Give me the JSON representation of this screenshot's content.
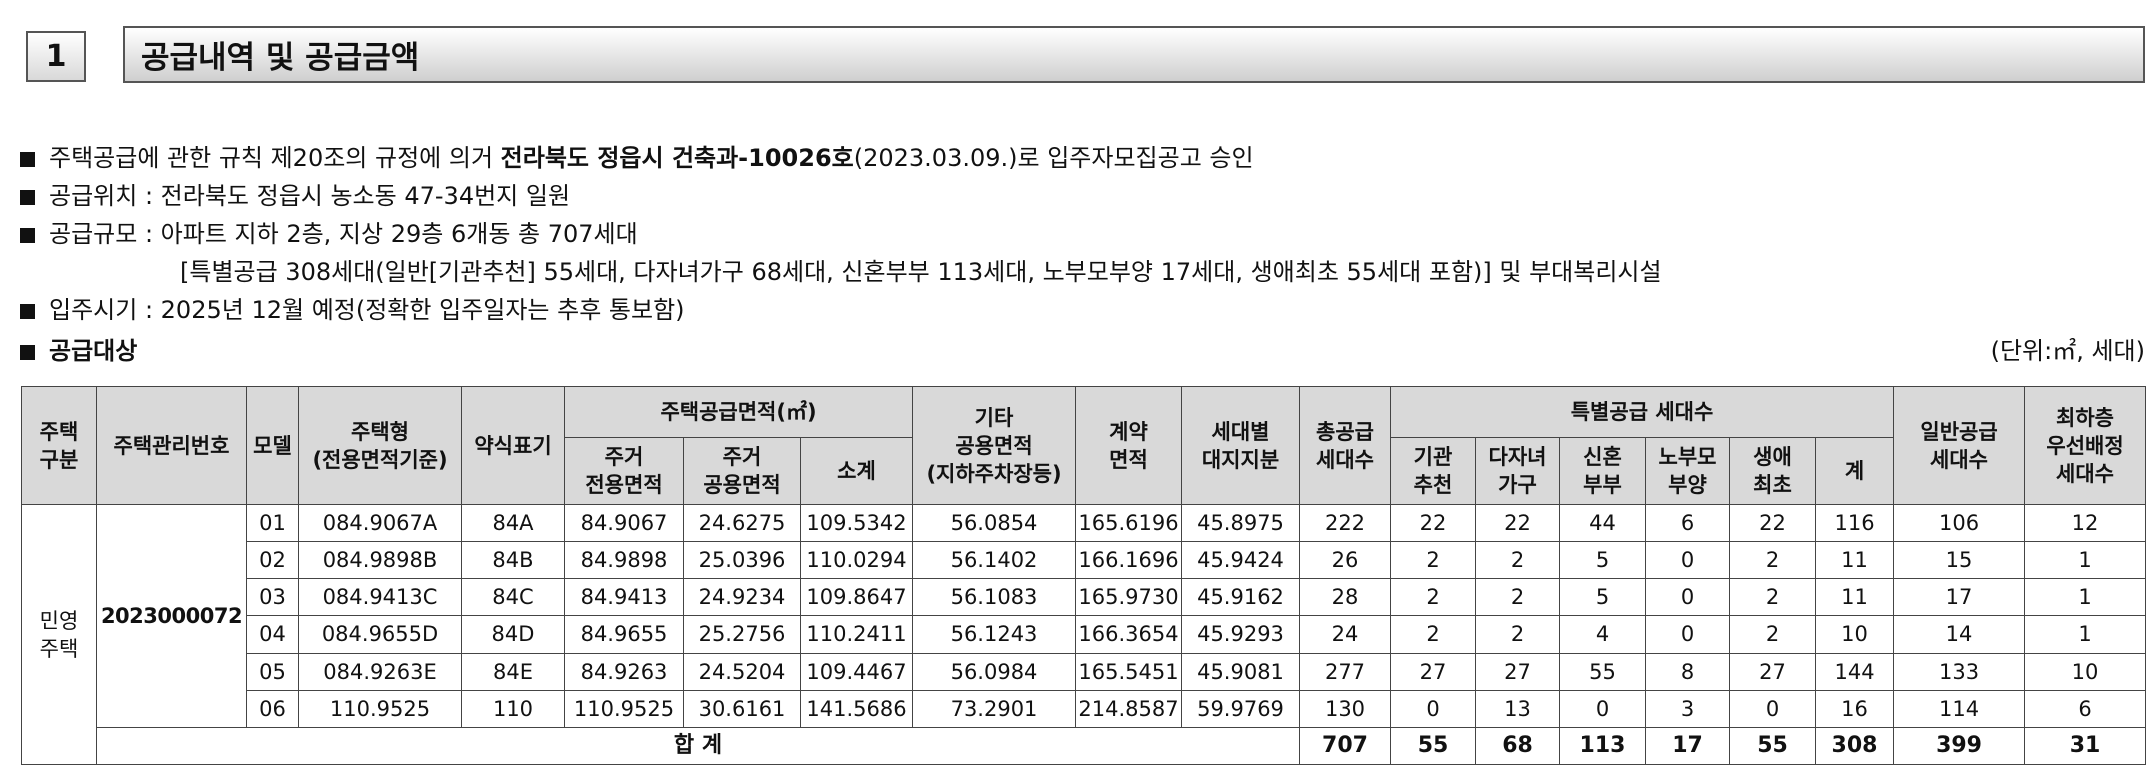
{
  "section": {
    "number": "1",
    "title": "공급내역 및 공급금액"
  },
  "notices": {
    "approval_prefix": "주택공급에 관한 규칙 제20조의 규정에 의거 ",
    "approval_bold": "전라북도 정읍시 건축과-10026호",
    "approval_suffix": "(2023.03.09.)로 입주자모집공고 승인",
    "location": "공급위치 : 전라북도 정읍시 농소동 47-34번지 일원",
    "scale": "공급규모 : 아파트 지하 2층, 지상 29층 6개동 총 707세대",
    "scale_detail": "[특별공급 308세대(일반[기관추천] 55세대, 다자녀가구 68세대, 신혼부부 113세대, 노부모부양 17세대, 생애최초 55세대 포함)] 및 부대복리시설",
    "move_in": "입주시기 : 2025년 12월 예정(정확한 입주일자는 추후 통보함)",
    "target_heading": "공급대상",
    "unit": "(단위:㎡, 세대)"
  },
  "table": {
    "headers": {
      "house_type_div": "주택\n구분",
      "mgmt_no": "주택관리번호",
      "model": "모델",
      "house_type": "주택형\n(전용면적기준)",
      "abbr": "약식표기",
      "supply_area": "주택공급면적(㎡)",
      "exclusive": "주거\n전용면적",
      "common": "주거\n공용면적",
      "subtotal": "소계",
      "other_common": "기타\n공용면적\n(지하주차장등)",
      "contract_area": "계약\n면적",
      "land_share": "세대별\n대지지분",
      "total_supply": "총공급\n세대수",
      "special": "특별공급 세대수",
      "inst": "기관\n추천",
      "multi": "다자녀\n가구",
      "newlywed": "신혼\n부부",
      "elderly": "노부모\n부양",
      "first": "생애\n최초",
      "special_sum": "계",
      "general": "일반공급\n세대수",
      "lowest_floor": "최하층\n우선배정\n세대수"
    },
    "house_type_div": "민영\n주택",
    "mgmt_no": "2023000072",
    "rows": [
      {
        "model": "01",
        "type": "084.9067A",
        "abbr": "84A",
        "excl": "84.9067",
        "comm": "24.6275",
        "sub": "109.5342",
        "other": "56.0854",
        "contract": "165.6196",
        "land": "45.8975",
        "total": "222",
        "inst": "22",
        "multi": "22",
        "newly": "44",
        "elder": "6",
        "first": "22",
        "sp": "116",
        "gen": "106",
        "low": "12"
      },
      {
        "model": "02",
        "type": "084.9898B",
        "abbr": "84B",
        "excl": "84.9898",
        "comm": "25.0396",
        "sub": "110.0294",
        "other": "56.1402",
        "contract": "166.1696",
        "land": "45.9424",
        "total": "26",
        "inst": "2",
        "multi": "2",
        "newly": "5",
        "elder": "0",
        "first": "2",
        "sp": "11",
        "gen": "15",
        "low": "1"
      },
      {
        "model": "03",
        "type": "084.9413C",
        "abbr": "84C",
        "excl": "84.9413",
        "comm": "24.9234",
        "sub": "109.8647",
        "other": "56.1083",
        "contract": "165.9730",
        "land": "45.9162",
        "total": "28",
        "inst": "2",
        "multi": "2",
        "newly": "5",
        "elder": "0",
        "first": "2",
        "sp": "11",
        "gen": "17",
        "low": "1"
      },
      {
        "model": "04",
        "type": "084.9655D",
        "abbr": "84D",
        "excl": "84.9655",
        "comm": "25.2756",
        "sub": "110.2411",
        "other": "56.1243",
        "contract": "166.3654",
        "land": "45.9293",
        "total": "24",
        "inst": "2",
        "multi": "2",
        "newly": "4",
        "elder": "0",
        "first": "2",
        "sp": "10",
        "gen": "14",
        "low": "1"
      },
      {
        "model": "05",
        "type": "084.9263E",
        "abbr": "84E",
        "excl": "84.9263",
        "comm": "24.5204",
        "sub": "109.4467",
        "other": "56.0984",
        "contract": "165.5451",
        "land": "45.9081",
        "total": "277",
        "inst": "27",
        "multi": "27",
        "newly": "55",
        "elder": "8",
        "first": "27",
        "sp": "144",
        "gen": "133",
        "low": "10"
      },
      {
        "model": "06",
        "type": "110.9525",
        "abbr": "110",
        "excl": "110.9525",
        "comm": "30.6161",
        "sub": "141.5686",
        "other": "73.2901",
        "contract": "214.8587",
        "land": "59.9769",
        "total": "130",
        "inst": "0",
        "multi": "13",
        "newly": "0",
        "elder": "3",
        "first": "0",
        "sp": "16",
        "gen": "114",
        "low": "6"
      }
    ],
    "total": {
      "label": "합 계",
      "total": "707",
      "inst": "55",
      "multi": "68",
      "newly": "113",
      "elder": "17",
      "first": "55",
      "sp": "308",
      "gen": "399",
      "low": "31"
    }
  }
}
